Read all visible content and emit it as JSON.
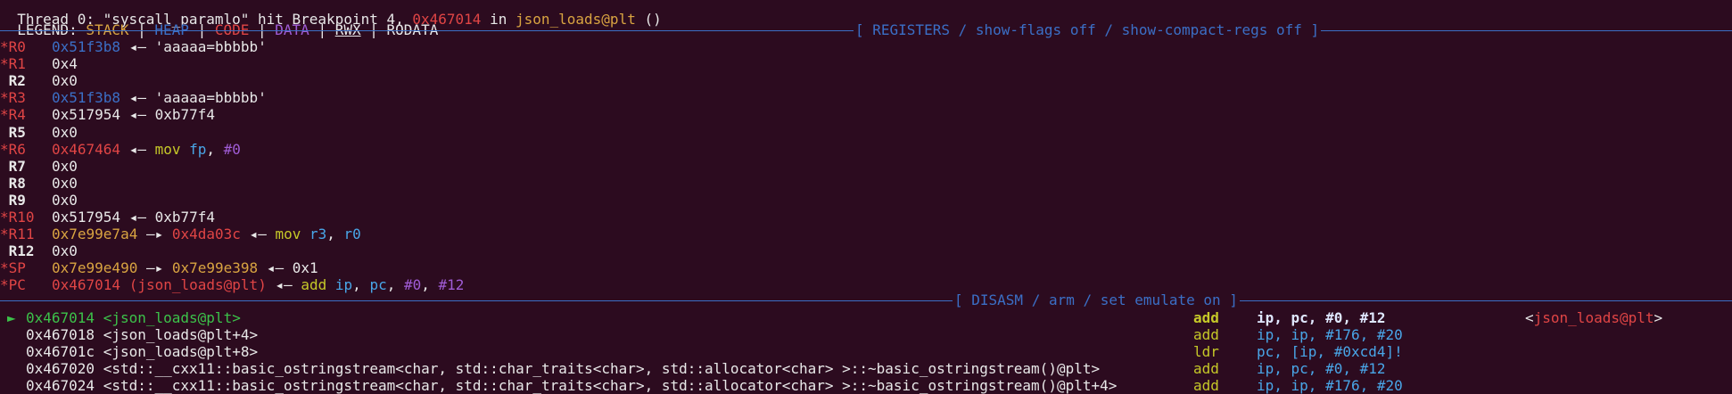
{
  "header": {
    "thread_line": {
      "prefix": "Thread 0: \"syscall_paramlo\" hit Breakpoint 4, ",
      "fn_hint": "0x467014",
      "mid": " in ",
      "fn": "json_loads@plt",
      "suffix": " ()"
    },
    "legend": {
      "label": "LEGEND: ",
      "stack": "STACK",
      "sep": " | ",
      "heap": "HEAP",
      "code": "CODE",
      "data": "DATA",
      "rwx": "RWX",
      "rodata": "RODATA"
    }
  },
  "registers_panel": {
    "title": "[ REGISTERS / show-flags off / show-compact-regs off ]",
    "rows": [
      {
        "mark": "*",
        "name": "R0",
        "val": "0x51f3b8",
        "val_color": "#3b6fc6",
        "rest": [
          {
            "t": " ◂— 'aaaaa=bbbbb'",
            "c": "#e8e8e8"
          }
        ]
      },
      {
        "mark": "*",
        "name": "R1",
        "val": "0x4",
        "val_color": "#e8e8e8",
        "rest": []
      },
      {
        "mark": " ",
        "name": "R2",
        "val": "0x0",
        "val_color": "#e8e8e8",
        "rest": []
      },
      {
        "mark": "*",
        "name": "R3",
        "val": "0x51f3b8",
        "val_color": "#3b6fc6",
        "rest": [
          {
            "t": " ◂— 'aaaaa=bbbbb'",
            "c": "#e8e8e8"
          }
        ]
      },
      {
        "mark": "*",
        "name": "R4",
        "val": "0x517954",
        "val_color": "#e8e8e8",
        "rest": [
          {
            "t": " ◂— 0xb77f4",
            "c": "#e8e8e8"
          }
        ]
      },
      {
        "mark": " ",
        "name": "R5",
        "val": "0x0",
        "val_color": "#e8e8e8",
        "rest": []
      },
      {
        "mark": "*",
        "name": "R6",
        "val": "0x467464",
        "val_color": "#e04545",
        "rest": [
          {
            "t": " ◂— ",
            "c": "#e8e8e8"
          },
          {
            "t": "mov",
            "c": "#c5c828"
          },
          {
            "t": " fp",
            "c": "#49a6e8"
          },
          {
            "t": ", ",
            "c": "#e8e8e8"
          },
          {
            "t": "#0",
            "c": "#a05cd6"
          }
        ]
      },
      {
        "mark": " ",
        "name": "R7",
        "val": "0x0",
        "val_color": "#e8e8e8",
        "rest": []
      },
      {
        "mark": " ",
        "name": "R8",
        "val": "0x0",
        "val_color": "#e8e8e8",
        "rest": []
      },
      {
        "mark": " ",
        "name": "R9",
        "val": "0x0",
        "val_color": "#e8e8e8",
        "rest": []
      },
      {
        "mark": "*",
        "name": "R10",
        "val": "0x517954",
        "val_color": "#e8e8e8",
        "rest": [
          {
            "t": " ◂— 0xb77f4",
            "c": "#e8e8e8"
          }
        ]
      },
      {
        "mark": "*",
        "name": "R11",
        "val": "0x7e99e7a4",
        "val_color": "#d9a441",
        "rest": [
          {
            "t": " —▸ ",
            "c": "#e8e8e8"
          },
          {
            "t": "0x4da03c",
            "c": "#e04545"
          },
          {
            "t": " ◂— ",
            "c": "#e8e8e8"
          },
          {
            "t": "mov",
            "c": "#c5c828"
          },
          {
            "t": " r3",
            "c": "#49a6e8"
          },
          {
            "t": ", ",
            "c": "#e8e8e8"
          },
          {
            "t": "r0",
            "c": "#49a6e8"
          }
        ]
      },
      {
        "mark": " ",
        "name": "R12",
        "val": "0x0",
        "val_color": "#e8e8e8",
        "rest": []
      },
      {
        "mark": "*",
        "name": "SP",
        "val": "0x7e99e490",
        "val_color": "#d9a441",
        "rest": [
          {
            "t": " —▸ ",
            "c": "#e8e8e8"
          },
          {
            "t": "0x7e99e398",
            "c": "#d9a441"
          },
          {
            "t": " ◂— 0x1",
            "c": "#e8e8e8"
          }
        ]
      },
      {
        "mark": "*",
        "name": "PC",
        "val": "0x467014 (json_loads@plt)",
        "val_color": "#e04545",
        "rest": [
          {
            "t": " ◂— ",
            "c": "#e8e8e8"
          },
          {
            "t": "add",
            "c": "#c5c828"
          },
          {
            "t": " ip",
            "c": "#49a6e8"
          },
          {
            "t": ", ",
            "c": "#e8e8e8"
          },
          {
            "t": "pc",
            "c": "#49a6e8"
          },
          {
            "t": ", ",
            "c": "#e8e8e8"
          },
          {
            "t": "#0",
            "c": "#a05cd6"
          },
          {
            "t": ", ",
            "c": "#e8e8e8"
          },
          {
            "t": "#12",
            "c": "#a05cd6"
          }
        ]
      }
    ]
  },
  "disasm_panel": {
    "title": "[ DISASM / arm / set emulate on ]",
    "rows": [
      {
        "current": true,
        "arrow": "►",
        "addr": "0x467014",
        "sym": "<json_loads@plt>",
        "op": "add",
        "args": "ip, pc, #0, #12",
        "target": "<json_loads@plt>"
      },
      {
        "current": false,
        "arrow": "",
        "addr": "0x467018",
        "sym": "<json_loads@plt+4>",
        "op": "add",
        "args": "ip, ip, #176, #20",
        "target": ""
      },
      {
        "current": false,
        "arrow": "",
        "addr": "0x46701c",
        "sym": "<json_loads@plt+8>",
        "op": "ldr",
        "args": "pc, [ip, #0xcd4]!",
        "target": ""
      },
      {
        "current": false,
        "arrow": "",
        "addr": "0x467020",
        "sym": "<std::__cxx11::basic_ostringstream<char, std::char_traits<char>, std::allocator<char> >::~basic_ostringstream()@plt>",
        "op": "add",
        "args": "ip, pc, #0, #12",
        "target": ""
      },
      {
        "current": false,
        "arrow": "",
        "addr": "0x467024",
        "sym": "<std::__cxx11::basic_ostringstream<char, std::char_traits<char>, std::allocator<char> >::~basic_ostringstream()@plt+4>",
        "op": "add",
        "args": "ip, ip, #176, #20",
        "target": ""
      }
    ]
  }
}
